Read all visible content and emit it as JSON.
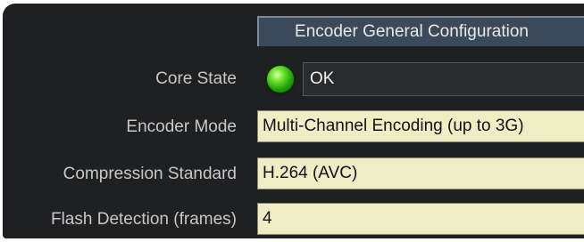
{
  "header": {
    "title": "Encoder General Configuration"
  },
  "core_state": {
    "label": "Core State",
    "status": "OK",
    "indicator_color": "#3cc81a"
  },
  "encoder_mode": {
    "label": "Encoder Mode",
    "value": "Multi-Channel Encoding (up to 3G)"
  },
  "compression_standard": {
    "label": "Compression Standard",
    "value": "H.264 (AVC)"
  },
  "flash_detection": {
    "label": "Flash Detection (frames)",
    "value": "4"
  },
  "colors": {
    "panel_background": "#1f2022",
    "header_background": "#3b4a5a",
    "field_background": "#efedc4"
  }
}
